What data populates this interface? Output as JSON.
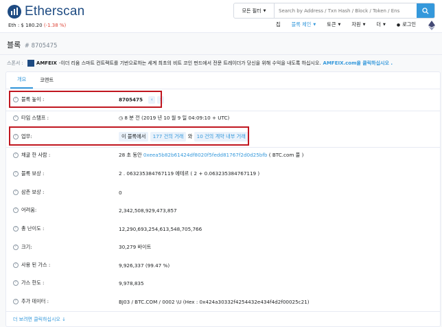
{
  "header": {
    "logo_text": "Etherscan",
    "price_label": "Eth : $ 180.20",
    "price_change": "(-1.38 %)",
    "search_filter": "모든 필터",
    "search_placeholder": "Search by Address / Txn Hash / Block / Token / Ens",
    "nav": [
      {
        "label": "집",
        "active": false,
        "caret": false
      },
      {
        "label": "블록 체인",
        "active": true,
        "caret": true
      },
      {
        "label": "토큰",
        "active": false,
        "caret": true
      },
      {
        "label": "자원",
        "active": false,
        "caret": true
      },
      {
        "label": "더",
        "active": false,
        "caret": true
      },
      {
        "label": "로그인",
        "active": false,
        "caret": false
      }
    ]
  },
  "page": {
    "title": "블록",
    "subtitle": "# 8705475"
  },
  "sponsor": {
    "label": "스폰서 :",
    "name": "AMFEIX",
    "text": "-이더 리움 스마트 컨트랙트를 기반으로하는 세계 최초의 비트 코인 펀드에서 전문 트레이더가 당신을 위해 수익을 내도록 하십시오.",
    "link": "AMFEIX.com을 클릭하십시오 ."
  },
  "tabs": [
    {
      "label": "개요",
      "active": true
    },
    {
      "label": "코멘트",
      "active": false
    }
  ],
  "rows": {
    "height": {
      "label": "블록 높이 :",
      "value": "8705475"
    },
    "timestamp": {
      "label": "타임 스탬프 :",
      "value": "8 분 전 (2019 년 10 월 9 일 04:09:10 + UTC)"
    },
    "transactions": {
      "label": "업무:",
      "prefix": "이 블록에서",
      "txns": "177 건의 거래",
      "and": "와",
      "internal": "10 건의 계약 내부 거래"
    },
    "miner": {
      "label": "채굴 한 사람 :",
      "prefix": "28 초 동안",
      "address": "0xeea5b82b61424df8020f5fedd81767f2d0d25bfb",
      "pool": "( BTC.com 풀 )"
    },
    "reward": {
      "label": "블록 보상 :",
      "value": "2 . 063235384767119 에테르 ( 2 + 0.063235384767119 )"
    },
    "uncles": {
      "label": "삼촌 보상 :",
      "value": "0"
    },
    "difficulty": {
      "label": "어려움:",
      "value": "2,342,508,929,473,857"
    },
    "total_difficulty": {
      "label": "총 난이도 :",
      "value": "12,290,693,254,613,548,705,766"
    },
    "size": {
      "label": "크기:",
      "value": "30,279 바이트"
    },
    "gas_used": {
      "label": "사용 된 가스 :",
      "value": "9,926,337 (99.47 %)"
    },
    "gas_limit": {
      "label": "가스 한도 :",
      "value": "9,978,835"
    },
    "extra": {
      "label": "추가 데이터 :",
      "value": "BJ03 / BTC.COM / 0002 \\U (Hex : 0x424a30332f4254432e434f4d2f00025c21)"
    }
  },
  "more_label": "더 보려면 클릭하십시오",
  "colors": {
    "accent": "#3498db",
    "highlight": "#c0161f",
    "negative": "#de4437"
  }
}
